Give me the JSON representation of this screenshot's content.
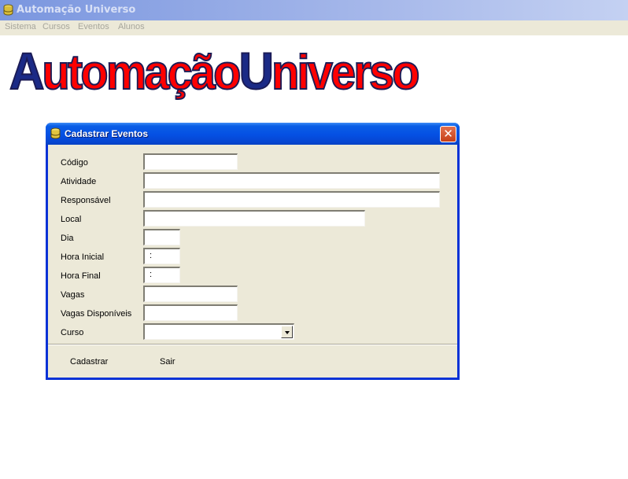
{
  "window": {
    "title": "Automação Universo",
    "icon": "database-icon"
  },
  "menu": {
    "items": [
      "Sistema",
      "Cursos",
      "Eventos",
      "Alunos"
    ]
  },
  "logo": {
    "initial_a": "A",
    "part_a": "utomação",
    "initial_u": "U",
    "part_u": "niverso",
    "colors": {
      "initials": "#1b2a86",
      "rest": "#ff0000"
    }
  },
  "dialog": {
    "title": "Cadastrar Eventos",
    "close_label": "✕",
    "labels": {
      "codigo": "Código",
      "atividade": "Atividade",
      "responsavel": "Responsável",
      "local": "Local",
      "dia": "Dia",
      "hora_inicial": "Hora Inicial",
      "hora_final": "Hora Final",
      "vagas": "Vagas",
      "vagas_disponiveis": "Vagas Disponíveis",
      "curso": "Curso"
    },
    "values": {
      "codigo": "",
      "atividade": "",
      "responsavel": "",
      "local": "",
      "dia": "",
      "hora_inicial": ":",
      "hora_final": ":",
      "vagas": "",
      "vagas_disponiveis": "",
      "curso": ""
    },
    "buttons": {
      "cadastrar": "Cadastrar",
      "sair": "Sair"
    }
  }
}
